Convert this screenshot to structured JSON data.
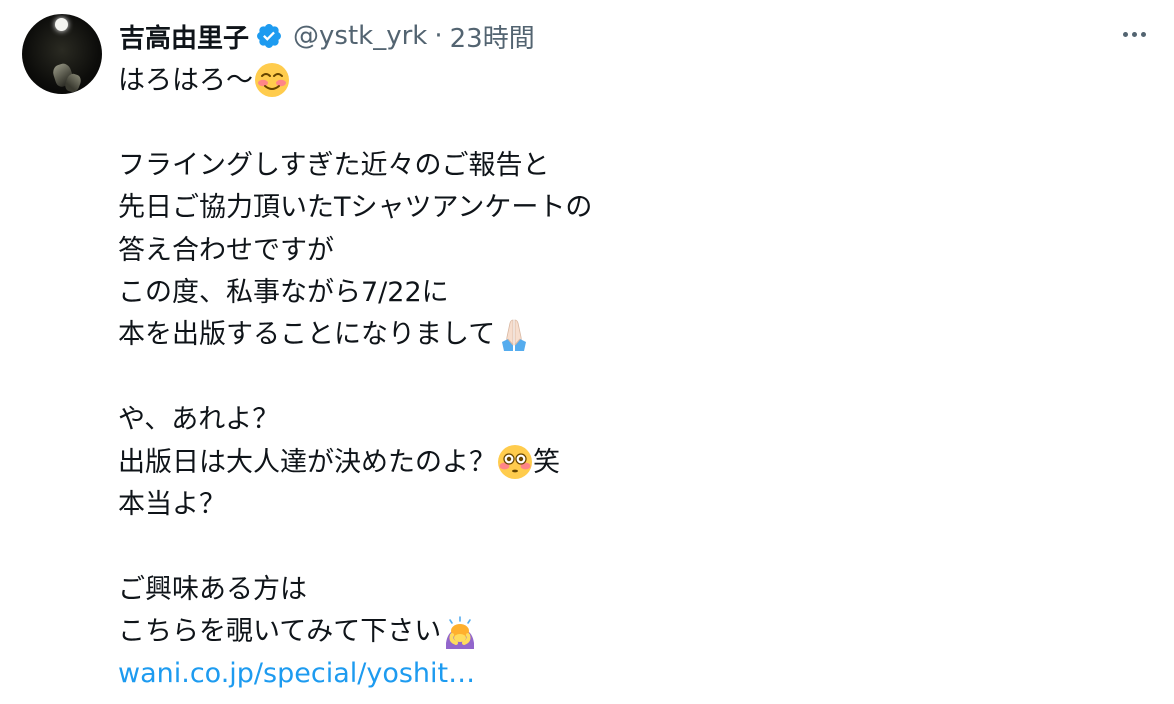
{
  "author": {
    "display_name": "吉高由里子",
    "handle": "@ystk_yrk",
    "separator": "·",
    "time": "23時間"
  },
  "tweet": {
    "lines": [
      {
        "text": "はろはろ〜",
        "emoji": "smiling-face-with-blushing-cheeks-icon"
      },
      {
        "text": ""
      },
      {
        "text": "フライングしすぎた近々のご報告と"
      },
      {
        "text": "先日ご協力頂いたTシャツアンケートの"
      },
      {
        "text": "答え合わせですが"
      },
      {
        "text": "この度、私事ながら7/22に"
      },
      {
        "text": "本を出版することになりまして",
        "emoji": "folded-hands-icon"
      },
      {
        "text": ""
      },
      {
        "text": "や、あれよ？"
      },
      {
        "text": "出版日は大人達が決めたのよ？",
        "emoji": "flushed-face-icon",
        "suffix": "笑"
      },
      {
        "text": "本当よ？"
      },
      {
        "text": ""
      },
      {
        "text": "ご興味ある方は"
      },
      {
        "text": "こちらを覗いてみて下さい",
        "emoji": "person-bowing-icon"
      }
    ],
    "link_text": "wani.co.jp/special/yoshit…"
  },
  "icons": {
    "verified": "verified-badge-icon",
    "more": "more-options-icon"
  },
  "colors": {
    "text": "#0f1419",
    "secondary": "#536471",
    "link": "#1d9bf0",
    "verified": "#1d9bf0"
  }
}
